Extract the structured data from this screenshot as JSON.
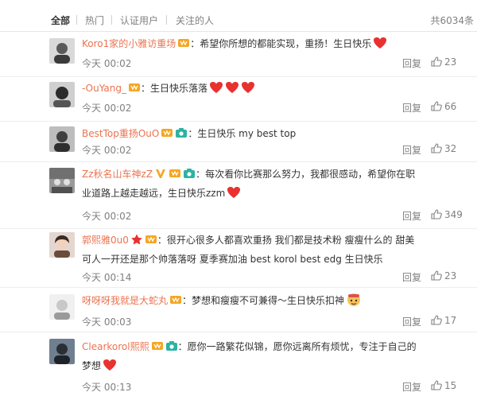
{
  "filter": {
    "tabs": [
      "全部",
      "热门",
      "认证用户",
      "关注的人"
    ],
    "total": "共6034条"
  },
  "actions": {
    "reply_label": "回复"
  },
  "colors": {
    "username": "#eb7350",
    "heart": "#e8322f",
    "vip": "#f5a623",
    "camera": "#2bb3a3"
  },
  "comments": [
    {
      "user": "Koro1家的小雅访重场",
      "badges": [
        "vip"
      ],
      "text": "希望你所想的都能实现，重扬！生日快乐",
      "emojis": [
        "heart"
      ],
      "time": "今天 00:02",
      "likes": "23"
    },
    {
      "user": "-OuYang_",
      "badges": [
        "vip"
      ],
      "text": "生日快乐落落",
      "emojis": [
        "heart",
        "heart",
        "heart"
      ],
      "time": "今天 00:02",
      "likes": "66"
    },
    {
      "user": "BestTop重扬OuO",
      "badges": [
        "vip",
        "camera"
      ],
      "text": "生日快乐 my best top",
      "emojis": [],
      "time": "今天 00:02",
      "likes": "32"
    },
    {
      "user": "Zz秋名山车神zZ",
      "badges": [
        "v",
        "vip",
        "camera"
      ],
      "text": "每次看你比赛那么努力，我都很感动，希望你在职业道路上越走越远，生日快乐zzm",
      "emojis": [
        "heart"
      ],
      "time": "今天 00:02",
      "likes": "349"
    },
    {
      "user": "郭熙雅0u0",
      "badges": [
        "star",
        "vip"
      ],
      "text": "很开心很多人都喜欢重扬 我们都是技术粉 瘦瘦什么的 甜美可人一开还是那个帅落落呀 夏季赛加油 best korol best edg 生日快乐",
      "emojis": [],
      "time": "今天 00:14",
      "likes": "23"
    },
    {
      "user": "呀呀呀我就是大蛇丸",
      "badges": [
        "vip"
      ],
      "text": "梦想和瘦瘦不可兼得～生日快乐扣神",
      "emojis": [
        "face"
      ],
      "time": "今天 00:03",
      "likes": "17"
    },
    {
      "user": "Clearkorol熙熙",
      "badges": [
        "vip",
        "camera"
      ],
      "text": "愿你一路繁花似锦，愿你远离所有烦忧，专注于自己的梦想",
      "emojis": [
        "heart"
      ],
      "time": "今天 00:13",
      "likes": "15"
    }
  ]
}
